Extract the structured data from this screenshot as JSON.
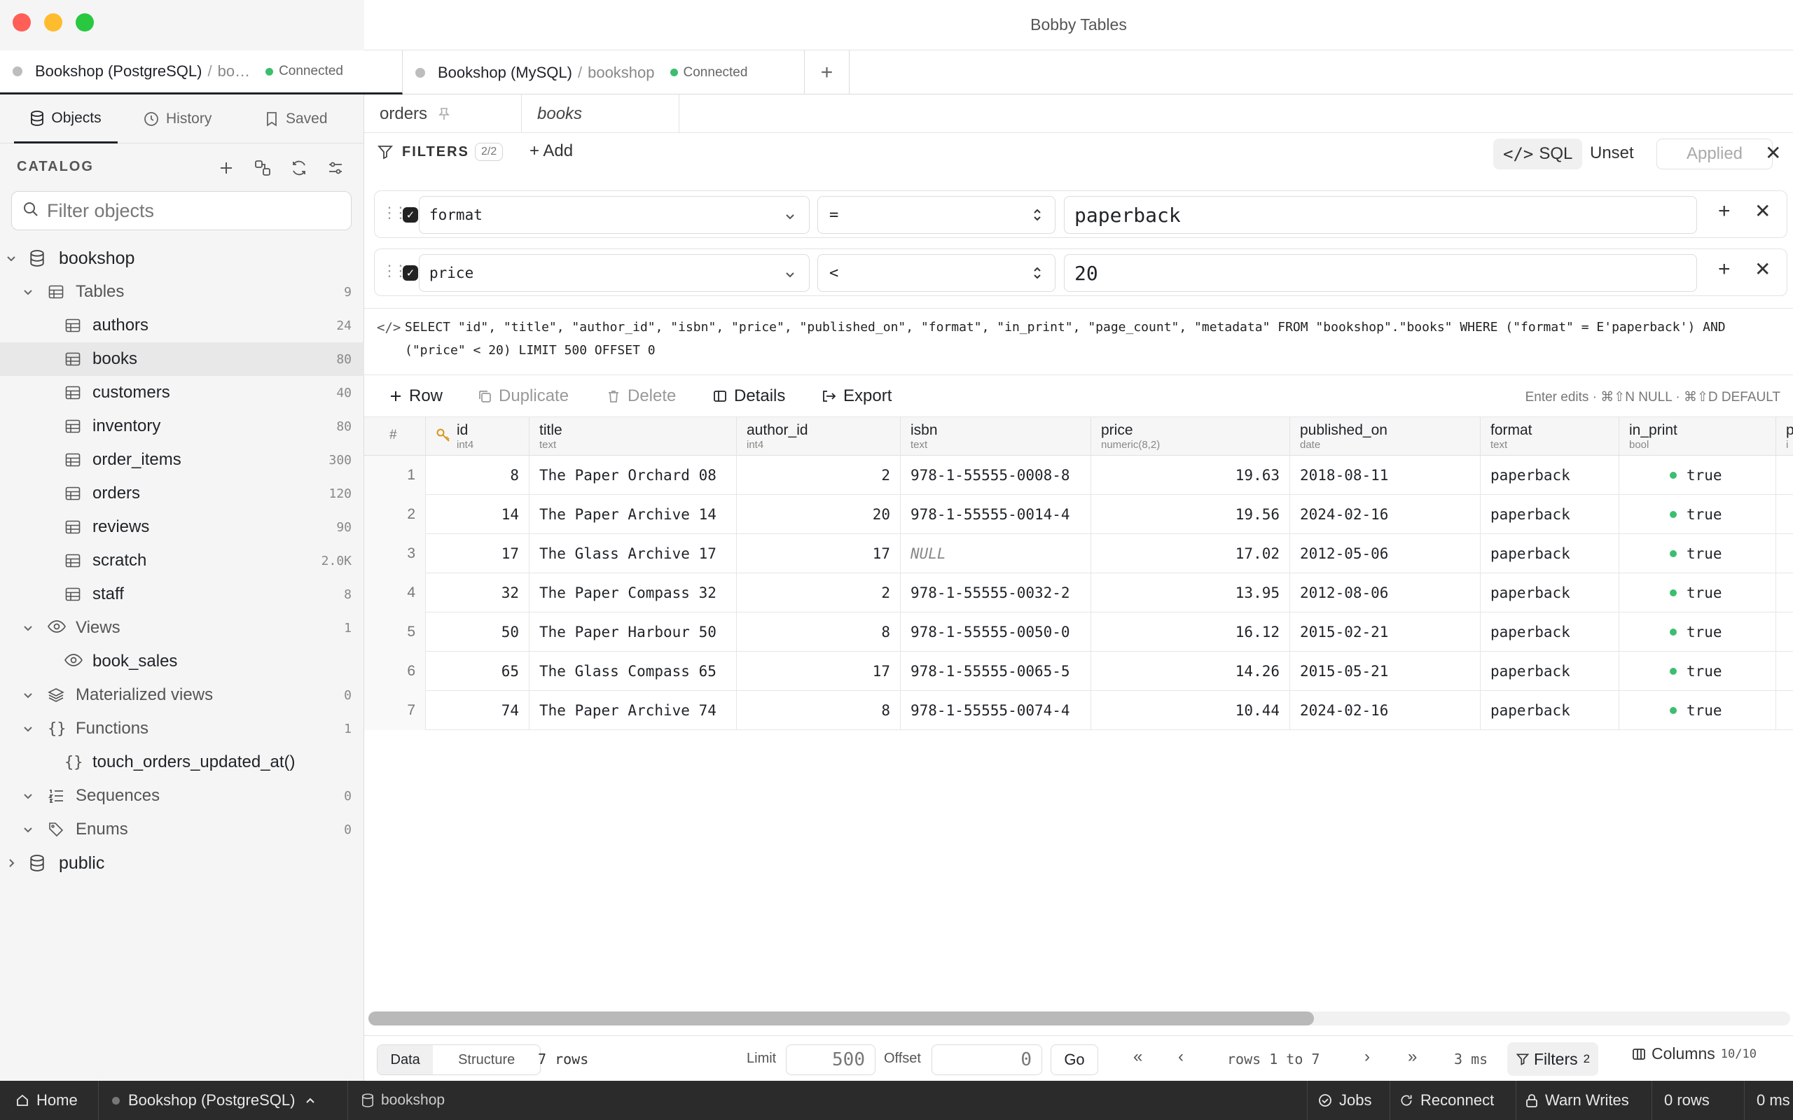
{
  "window": {
    "title": "Bobby Tables"
  },
  "connections": [
    {
      "name": "Bookshop (PostgreSQL)",
      "db": "bo…",
      "status": "Connected"
    },
    {
      "name": "Bookshop (MySQL)",
      "db": "bookshop",
      "status": "Connected"
    }
  ],
  "add_connection": "+",
  "sidebar": {
    "tabs": {
      "objects": "Objects",
      "history": "History",
      "saved": "Saved"
    },
    "catalog_label": "CATALOG",
    "filter_placeholder": "Filter objects",
    "tree": {
      "db": "bookshop",
      "tables_label": "Tables",
      "tables_count": "9",
      "tables": [
        {
          "name": "authors",
          "count": "24"
        },
        {
          "name": "books",
          "count": "80"
        },
        {
          "name": "customers",
          "count": "40"
        },
        {
          "name": "inventory",
          "count": "80"
        },
        {
          "name": "order_items",
          "count": "300"
        },
        {
          "name": "orders",
          "count": "120"
        },
        {
          "name": "reviews",
          "count": "90"
        },
        {
          "name": "scratch",
          "count": "2.0K"
        },
        {
          "name": "staff",
          "count": "8"
        }
      ],
      "views_label": "Views",
      "views_count": "1",
      "views": [
        "book_sales"
      ],
      "matviews_label": "Materialized views",
      "matviews_count": "0",
      "functions_label": "Functions",
      "functions_count": "1",
      "functions": [
        "touch_orders_updated_at()"
      ],
      "sequences_label": "Sequences",
      "sequences_count": "0",
      "enums_label": "Enums",
      "enums_count": "0",
      "db2": "public"
    }
  },
  "doc_tabs": {
    "orders": "orders",
    "books": "books"
  },
  "filters": {
    "title": "FILTERS",
    "count": "2/2",
    "add": "+ Add",
    "sql": "SQL",
    "unset": "Unset",
    "applied": "Applied",
    "rows": [
      {
        "column": "format",
        "op": "=",
        "value": "paperback"
      },
      {
        "column": "price",
        "op": "<",
        "value": "20"
      }
    ]
  },
  "sql_preview": "SELECT \"id\", \"title\", \"author_id\", \"isbn\", \"price\", \"published_on\", \"format\", \"in_print\", \"page_count\", \"metadata\" FROM \"bookshop\".\"books\" WHERE (\"format\" = E'paperback') AND (\"price\" < 20) LIMIT 500 OFFSET 0",
  "toolbar": {
    "row": "Row",
    "duplicate": "Duplicate",
    "delete": "Delete",
    "details": "Details",
    "export": "Export",
    "hint": "Enter edits · ⌘⇧N NULL · ⌘⇧D DEFAULT"
  },
  "grid": {
    "rownum_header": "#",
    "columns": [
      {
        "name": "id",
        "type": "int4"
      },
      {
        "name": "title",
        "type": "text"
      },
      {
        "name": "author_id",
        "type": "int4"
      },
      {
        "name": "isbn",
        "type": "text"
      },
      {
        "name": "price",
        "type": "numeric(8,2)"
      },
      {
        "name": "published_on",
        "type": "date"
      },
      {
        "name": "format",
        "type": "text"
      },
      {
        "name": "in_print",
        "type": "bool"
      },
      {
        "name": "p",
        "type": "i"
      }
    ],
    "rows": [
      {
        "n": "1",
        "id": "8",
        "title": "The Paper Orchard 08",
        "author_id": "2",
        "isbn": "978-1-55555-0008-8",
        "price": "19.63",
        "published_on": "2018-08-11",
        "format": "paperback",
        "in_print": "true"
      },
      {
        "n": "2",
        "id": "14",
        "title": "The Paper Archive 14",
        "author_id": "20",
        "isbn": "978-1-55555-0014-4",
        "price": "19.56",
        "published_on": "2024-02-16",
        "format": "paperback",
        "in_print": "true"
      },
      {
        "n": "3",
        "id": "17",
        "title": "The Glass Archive 17",
        "author_id": "17",
        "isbn": "NULL",
        "price": "17.02",
        "published_on": "2012-05-06",
        "format": "paperback",
        "in_print": "true"
      },
      {
        "n": "4",
        "id": "32",
        "title": "The Paper Compass 32",
        "author_id": "2",
        "isbn": "978-1-55555-0032-2",
        "price": "13.95",
        "published_on": "2012-08-06",
        "format": "paperback",
        "in_print": "true"
      },
      {
        "n": "5",
        "id": "50",
        "title": "The Paper Harbour 50",
        "author_id": "8",
        "isbn": "978-1-55555-0050-0",
        "price": "16.12",
        "published_on": "2015-02-21",
        "format": "paperback",
        "in_print": "true"
      },
      {
        "n": "6",
        "id": "65",
        "title": "The Glass Compass 65",
        "author_id": "17",
        "isbn": "978-1-55555-0065-5",
        "price": "14.26",
        "published_on": "2015-05-21",
        "format": "paperback",
        "in_print": "true"
      },
      {
        "n": "7",
        "id": "74",
        "title": "The Paper Archive 74",
        "author_id": "8",
        "isbn": "978-1-55555-0074-4",
        "price": "10.44",
        "published_on": "2024-02-16",
        "format": "paperback",
        "in_print": "true"
      }
    ]
  },
  "bottom": {
    "data": "Data",
    "structure": "Structure",
    "rows": "7 rows",
    "limit_label": "Limit",
    "limit": "500",
    "offset_label": "Offset",
    "offset": "0",
    "go": "Go",
    "range": "rows 1 to 7",
    "time": "3 ms",
    "filters": "Filters",
    "filters_count": "2",
    "columns": "Columns",
    "columns_count": "10/10"
  },
  "status": {
    "home": "Home",
    "connection": "Bookshop (PostgreSQL)",
    "db": "bookshop",
    "jobs": "Jobs",
    "reconnect": "Reconnect",
    "warn": "Warn Writes",
    "rows": "0 rows",
    "time": "0 ms"
  },
  "colors": {
    "accent": "#1f2328",
    "connected": "#3ebd6f",
    "close": "#ff5f57",
    "minimize": "#febc2e",
    "zoom": "#28c840",
    "statusbar": "#2b2b2b"
  },
  "icons": [
    "database-icon",
    "table-icon",
    "view-icon",
    "layers-icon",
    "braces-icon",
    "list-ordered-icon",
    "tag-icon",
    "clock-icon",
    "bookmark-icon",
    "filter-icon",
    "key-icon",
    "search-icon"
  ]
}
